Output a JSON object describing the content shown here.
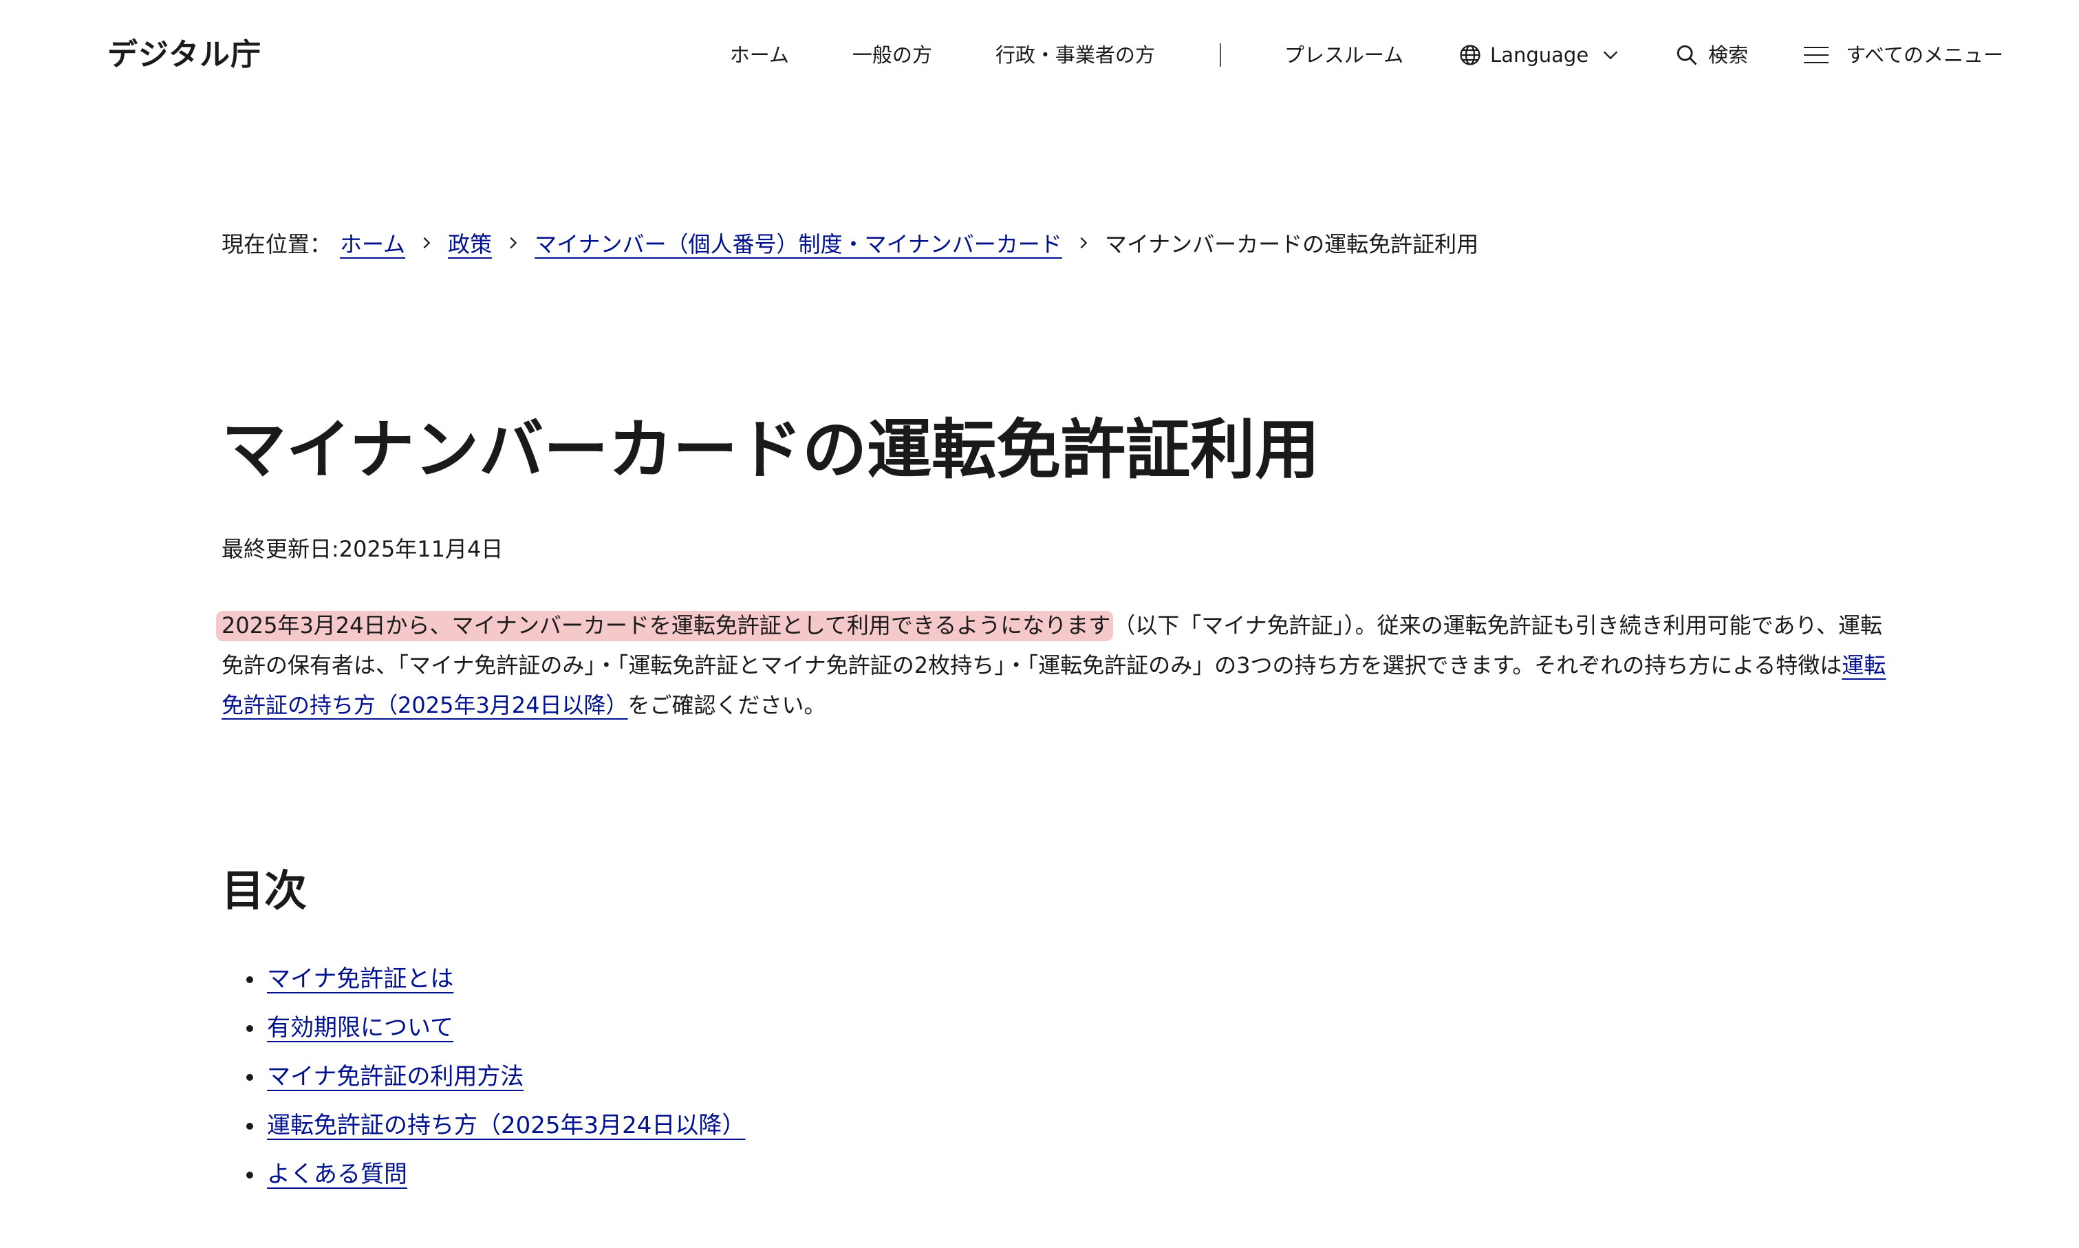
{
  "header": {
    "logo": "デジタル庁",
    "nav": {
      "home": "ホーム",
      "general": "一般の方",
      "business": "行政・事業者の方",
      "press": "プレスルーム",
      "language": "Language",
      "search": "検索",
      "menu": "すべてのメニュー"
    },
    "icons": {
      "language": "globe-icon",
      "language_caret": "chevron-down-icon",
      "search": "search-icon",
      "menu": "hamburger-icon"
    }
  },
  "breadcrumb": {
    "prefix": "現在位置：",
    "items": [
      "ホーム",
      "政策",
      "マイナンバー（個人番号）制度・マイナンバーカード"
    ],
    "current": "マイナンバーカードの運転免許証利用"
  },
  "main": {
    "title": "マイナンバーカードの運転免許証利用",
    "updated": "最終更新日:2025年11月4日",
    "intro": {
      "highlight": "2025年3月24日から、マイナンバーカードを運転免許証として利用できるようになります",
      "text1": "（以下「マイナ免許証」）。従来の運転免許証も引き続き利用可能であり、運転免許の保有者は、「マイナ免許証のみ」・「運転免許証とマイナ免許証の2枚持ち」・「運転免許証のみ」の3つの持ち方を選択できます。それぞれの持ち方による特徴は",
      "link": "運転免許証の持ち方（2025年3月24日以降）",
      "text2": "をご確認ください。"
    },
    "toc": {
      "title": "目次",
      "items": [
        "マイナ免許証とは",
        "有効期限について",
        "マイナ免許証の利用方法",
        "運転免許証の持ち方（2025年3月24日以降）",
        "よくある質問"
      ]
    }
  },
  "colors": {
    "link": "#00118f",
    "highlight": "#f5c9c9",
    "text": "#1a1a1a"
  }
}
